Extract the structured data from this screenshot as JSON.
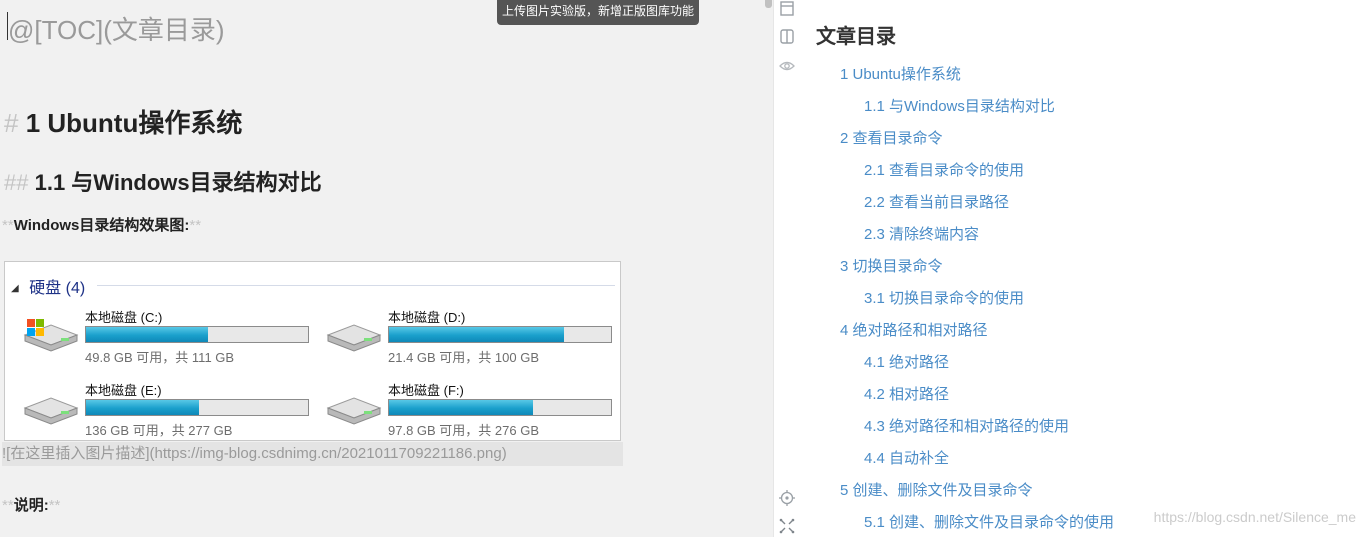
{
  "tooltip": "上传图片实验版，新增正版图库功能",
  "editor": {
    "toc_line": "@[TOC](文章目录)",
    "h1_marker": "#",
    "h1_text": "1 Ubuntu操作系统",
    "h2_marker": "##",
    "h2_text": "1.1 与Windows目录结构对比",
    "bold_marker": "**",
    "windows_caption": "Windows目录结构效果图:",
    "image_alt_line": "![在这里插入图片描述](https://img-blog.csdnimg.cn/2021011709221186.png)",
    "explain_label": "说明:"
  },
  "explorer_image": {
    "group_title": "硬盘",
    "group_count": "(4)",
    "disks": [
      {
        "name": "本地磁盘 (C:)",
        "info": "49.8 GB 可用，共 111 GB",
        "used": 0.55,
        "icon": "windows-drive-icon"
      },
      {
        "name": "本地磁盘 (D:)",
        "info": "21.4 GB 可用，共 100 GB",
        "used": 0.79,
        "icon": "hard-drive-icon"
      },
      {
        "name": "本地磁盘 (E:)",
        "info": "136 GB 可用，共 277 GB",
        "used": 0.51,
        "icon": "hard-drive-icon"
      },
      {
        "name": "本地磁盘 (F:)",
        "info": "97.8 GB 可用，共 276 GB",
        "used": 0.65,
        "icon": "hard-drive-icon"
      }
    ]
  },
  "preview": {
    "toc_title": "文章目录",
    "toc_items": [
      {
        "label": "1 Ubuntu操作系统",
        "level": 1
      },
      {
        "label": "1.1 与Windows目录结构对比",
        "level": 2
      },
      {
        "label": "2 查看目录命令",
        "level": 1
      },
      {
        "label": "2.1 查看目录命令的使用",
        "level": 2
      },
      {
        "label": "2.2 查看当前目录路径",
        "level": 2
      },
      {
        "label": "2.3 清除终端内容",
        "level": 2
      },
      {
        "label": "3 切换目录命令",
        "level": 1
      },
      {
        "label": "3.1 切换目录命令的使用",
        "level": 2
      },
      {
        "label": "4 绝对路径和相对路径",
        "level": 1
      },
      {
        "label": "4.1 绝对路径",
        "level": 2
      },
      {
        "label": "4.2 相对路径",
        "level": 2
      },
      {
        "label": "4.3 绝对路径和相对路径的使用",
        "level": 2
      },
      {
        "label": "4.4 自动补全",
        "level": 2
      },
      {
        "label": "5 创建、删除文件及目录命令",
        "level": 1
      },
      {
        "label": "5.1 创建、删除文件及目录命令的使用",
        "level": 2
      }
    ],
    "watermark": "https://blog.csdn.net/Silence_me",
    "tools": [
      "layout-icon",
      "split-view-icon",
      "eye-icon",
      "locate-icon",
      "fullscreen-icon"
    ]
  },
  "colors": {
    "link": "#4a8cc7",
    "editor_bg": "#f1f1f1",
    "heading": "#222222",
    "disk_bar": "#1aa0cc"
  }
}
